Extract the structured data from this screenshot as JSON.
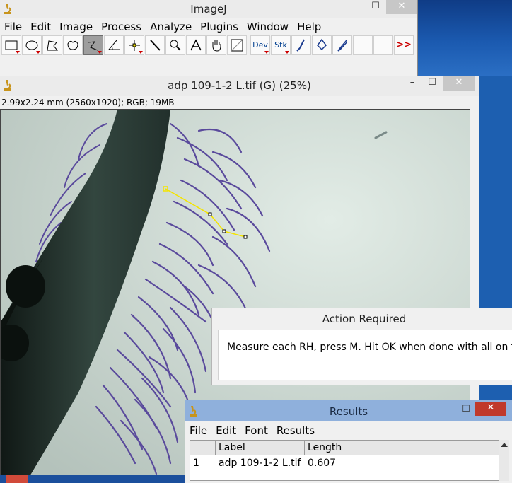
{
  "imagej": {
    "title": "ImageJ",
    "menu": [
      "File",
      "Edit",
      "Image",
      "Process",
      "Analyze",
      "Plugins",
      "Window",
      "Help"
    ],
    "tools": [
      {
        "name": "rectangle-tool",
        "icon": "rectangle-icon"
      },
      {
        "name": "oval-tool",
        "icon": "oval-icon"
      },
      {
        "name": "polygon-tool",
        "icon": "polygon-icon"
      },
      {
        "name": "freehand-tool",
        "icon": "freehand-icon"
      },
      {
        "name": "segmented-line-tool",
        "icon": "segmented-line-icon",
        "pressed": true
      },
      {
        "name": "angle-tool",
        "icon": "angle-icon"
      },
      {
        "name": "point-tool",
        "icon": "point-icon"
      },
      {
        "name": "wand-tool",
        "icon": "wand-icon"
      },
      {
        "name": "magnifier-tool",
        "icon": "magnifier-icon"
      },
      {
        "name": "text-tool",
        "icon": "text-icon"
      },
      {
        "name": "hand-tool",
        "icon": "hand-icon"
      },
      {
        "name": "color-picker-tool",
        "icon": "color-picker-icon"
      }
    ],
    "tool_dev_label": "Dev",
    "tool_stk_label": "Stk",
    "more_tools_label": ">>"
  },
  "image_window": {
    "title": "adp 109-1-2 L.tif (G) (25%)",
    "info": "2.99x2.24 mm (2560x1920); RGB; 19MB"
  },
  "action_dialog": {
    "title": "Action Required",
    "message": "Measure each RH, press M. Hit OK when done with all on this"
  },
  "results": {
    "title": "Results",
    "menu": [
      "File",
      "Edit",
      "Font",
      "Results"
    ],
    "columns": [
      "",
      "Label",
      "Length"
    ],
    "rows": [
      {
        "index": "1",
        "label": "adp 109-1-2 L.tif",
        "length": "0.607"
      }
    ]
  },
  "colors": {
    "selection_line": "#f4e400",
    "root_hair": "#5a4a9c",
    "results_titlebar": "#8fb0dc",
    "close_red": "#c0392b"
  }
}
